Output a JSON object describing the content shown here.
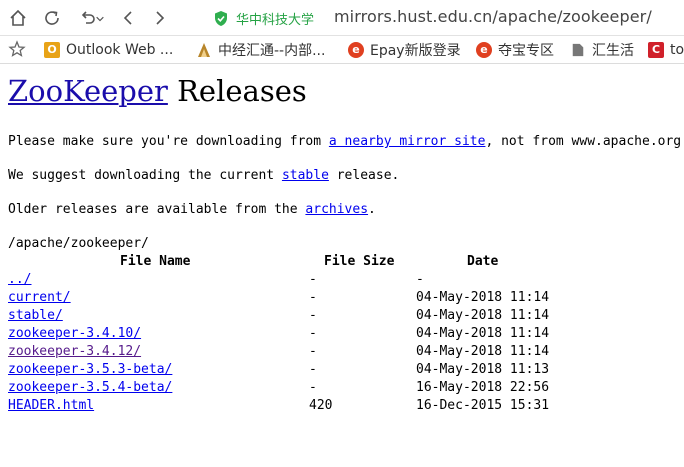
{
  "browser": {
    "site_name": "华中科技大学",
    "url": "mirrors.hust.edu.cn/apache/zookeeper/",
    "bookmarks": [
      {
        "label": "Outlook Web ...",
        "icon": "outlook-icon",
        "color": "#e8a317"
      },
      {
        "label": "中经汇通--内部...",
        "icon": "zhongjing-icon",
        "color": "#b8862a"
      },
      {
        "label": "Epay新版登录",
        "icon": "epay-icon",
        "color": "#e04020"
      },
      {
        "label": "夺宝专区",
        "icon": "duobao-icon",
        "color": "#e04020"
      },
      {
        "label": "汇生活",
        "icon": "document-icon",
        "color": "#777777"
      },
      {
        "label": "to",
        "icon": "c-icon",
        "color": "#d0202a"
      }
    ]
  },
  "page": {
    "title_link": "ZooKeeper",
    "title_rest": " Releases",
    "line1_pre": "Please make sure you're downloading from ",
    "line1_link": "a nearby mirror site",
    "line1_post": ", not from www.apache.org.",
    "line2_pre": "We suggest downloading the current ",
    "line2_link": "stable",
    "line2_post": " release.",
    "line3_pre": "Older releases are available from the ",
    "line3_link": "archives",
    "line3_post": ".",
    "listing_path": "/apache/zookeeper/",
    "columns": [
      "File Name",
      "File Size",
      "Date"
    ],
    "files": [
      {
        "name": "../",
        "size": "-",
        "date": "-",
        "visited": false
      },
      {
        "name": "current/",
        "size": "-",
        "date": "04-May-2018 11:14",
        "visited": false
      },
      {
        "name": "stable/",
        "size": "-",
        "date": "04-May-2018 11:14",
        "visited": false
      },
      {
        "name": "zookeeper-3.4.10/",
        "size": "-",
        "date": "04-May-2018 11:14",
        "visited": false
      },
      {
        "name": "zookeeper-3.4.12/",
        "size": "-",
        "date": "04-May-2018 11:14",
        "visited": true
      },
      {
        "name": "zookeeper-3.5.3-beta/",
        "size": "-",
        "date": "04-May-2018 11:13",
        "visited": false
      },
      {
        "name": "zookeeper-3.5.4-beta/",
        "size": "-",
        "date": "16-May-2018 22:56",
        "visited": false
      },
      {
        "name": "HEADER.html",
        "size": "420",
        "date": "16-Dec-2015 15:31",
        "visited": false
      }
    ]
  }
}
